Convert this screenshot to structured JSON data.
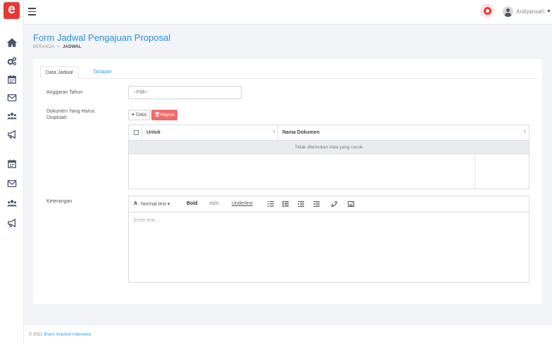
{
  "app": {
    "logo_letter": "e"
  },
  "sidebar": {
    "icons": [
      "home-icon",
      "gears-icon",
      "calendar-icon",
      "envelope-icon",
      "users-icon",
      "megaphone-icon",
      "calendar-icon",
      "envelope-icon",
      "users-icon",
      "megaphone-icon"
    ]
  },
  "header": {
    "user_name": "Ardiyansah"
  },
  "page": {
    "title": "Form Jadwal Pengajuan Proposal",
    "breadcrumb": {
      "home": "BERANDA",
      "separator": ">",
      "current": "JADWAL"
    }
  },
  "tabs": [
    {
      "label": "Data Jadwal",
      "active": true
    },
    {
      "label": "Tahapan",
      "active": false
    }
  ],
  "form": {
    "anggaran": {
      "label": "Anggaran Tahun",
      "value": "--Pilih--"
    },
    "dokumen": {
      "label": "Dokumen Yang Harus Diupload:",
      "add_button": "Data",
      "delete_button": "Hapus",
      "columns": [
        "Untuk",
        "Nama Dokumen"
      ],
      "empty_text": "Tidak ditemukan data yang cocok"
    },
    "keterangan": {
      "label": "Keterangan",
      "toolbar": {
        "font": "Normal text",
        "bold": "Bold",
        "italic": "Italic",
        "underline": "Underline"
      },
      "placeholder": "Enter text ..."
    }
  },
  "footer": {
    "prefix": "© 2021",
    "company": "Bravo Solution Indonesia"
  },
  "colors": {
    "brand": "#e53935",
    "accent": "#2a9df4",
    "danger": "#ef6b6b",
    "title": "#2a8fd8"
  }
}
